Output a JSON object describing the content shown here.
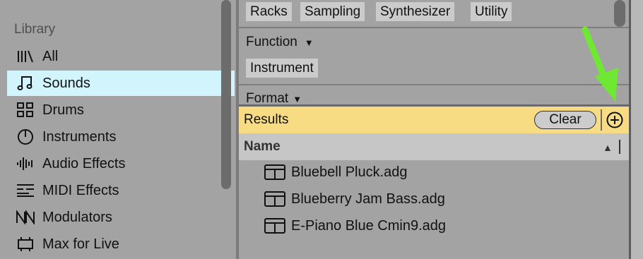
{
  "sidebar": {
    "heading": "Library",
    "items": [
      {
        "label": "All",
        "icon": "all-icon",
        "active": false
      },
      {
        "label": "Sounds",
        "icon": "music-note-icon",
        "active": true
      },
      {
        "label": "Drums",
        "icon": "drums-grid-icon",
        "active": false
      },
      {
        "label": "Instruments",
        "icon": "instrument-gauge-icon",
        "active": false
      },
      {
        "label": "Audio Effects",
        "icon": "audio-waveform-icon",
        "active": false
      },
      {
        "label": "MIDI Effects",
        "icon": "midi-effects-icon",
        "active": false
      },
      {
        "label": "Modulators",
        "icon": "modulator-icon",
        "active": false
      },
      {
        "label": "Max for Live",
        "icon": "max-for-live-icon",
        "active": false
      }
    ]
  },
  "filters": {
    "category_tags": [
      "Racks",
      "Sampling",
      "Synthesizer",
      "Utility"
    ],
    "function": {
      "title": "Function",
      "tags": [
        "Instrument"
      ]
    },
    "format": {
      "title": "Format"
    }
  },
  "results": {
    "label": "Results",
    "clear_label": "Clear",
    "add_icon": "add-circle-icon",
    "column_header": "Name",
    "files": [
      "Bluebell Pluck.adg",
      "Blueberry Jam Bass.adg",
      "E-Piano Blue Cmin9.adg"
    ]
  },
  "colors": {
    "sidebar_active": "#d2f5fd",
    "results_bar": "#f8dc84",
    "annotation_arrow": "#6fe834"
  }
}
